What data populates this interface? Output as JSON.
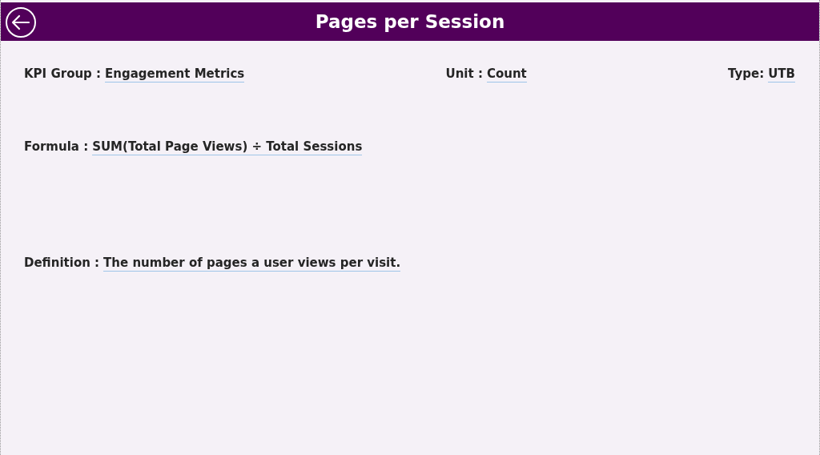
{
  "header": {
    "title": "Pages per Session"
  },
  "top_fields": [
    {
      "label": "KPI Group :",
      "value": "Engagement Metrics"
    },
    {
      "label": "Unit :",
      "value": "Count"
    },
    {
      "label": "Type:",
      "value": "UTB"
    }
  ],
  "formula": {
    "label": "Formula :",
    "value": "SUM(Total Page Views) ÷ Total Sessions"
  },
  "definition": {
    "label": "Definition :",
    "value": "The number of pages a user views per visit."
  }
}
